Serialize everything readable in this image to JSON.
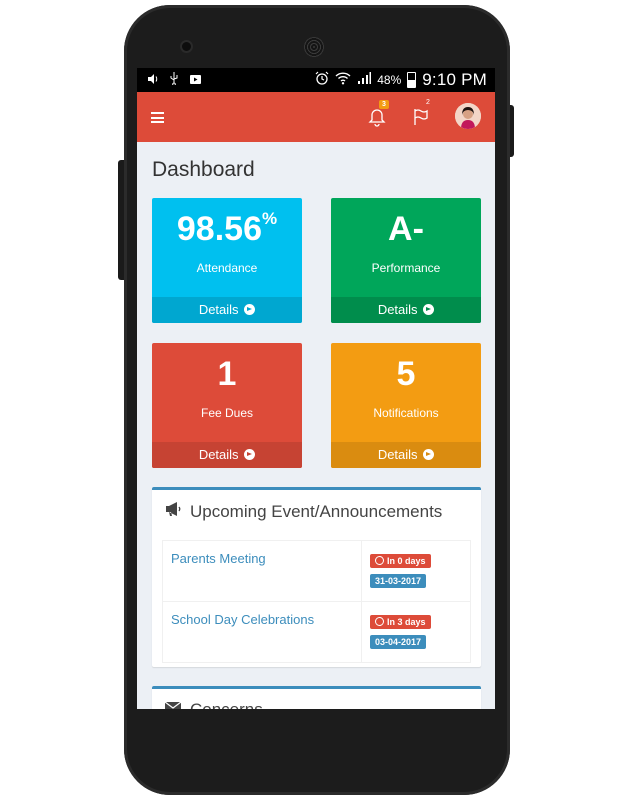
{
  "status_bar": {
    "battery_percent": "48%",
    "time": "9:10 PM"
  },
  "header": {
    "notifications_badge": "3",
    "flags_badge": "2"
  },
  "page": {
    "title": "Dashboard"
  },
  "tiles": [
    {
      "value": "98.56",
      "suffix": "%",
      "label": "Attendance",
      "footer": "Details",
      "color": "#00c0ef"
    },
    {
      "value": "A-",
      "label": "Performance",
      "footer": "Details",
      "color": "#00a65a"
    },
    {
      "value": "1",
      "label": "Fee Dues",
      "footer": "Details",
      "color": "#dd4b39"
    },
    {
      "value": "5",
      "label": "Notifications",
      "footer": "Details",
      "color": "#f39c12"
    }
  ],
  "events_box": {
    "title": "Upcoming Event/Announcements",
    "rows": [
      {
        "name": "Parents Meeting",
        "countdown": "In 0 days",
        "date": "31-03-2017"
      },
      {
        "name": "School Day Celebrations",
        "countdown": "In 3 days",
        "date": "03-04-2017"
      }
    ]
  },
  "concerns_box": {
    "title": "Concerns"
  },
  "colors": {
    "header": "#dd4b39",
    "accent": "#3c8dbc",
    "background": "#ecf0f5"
  }
}
